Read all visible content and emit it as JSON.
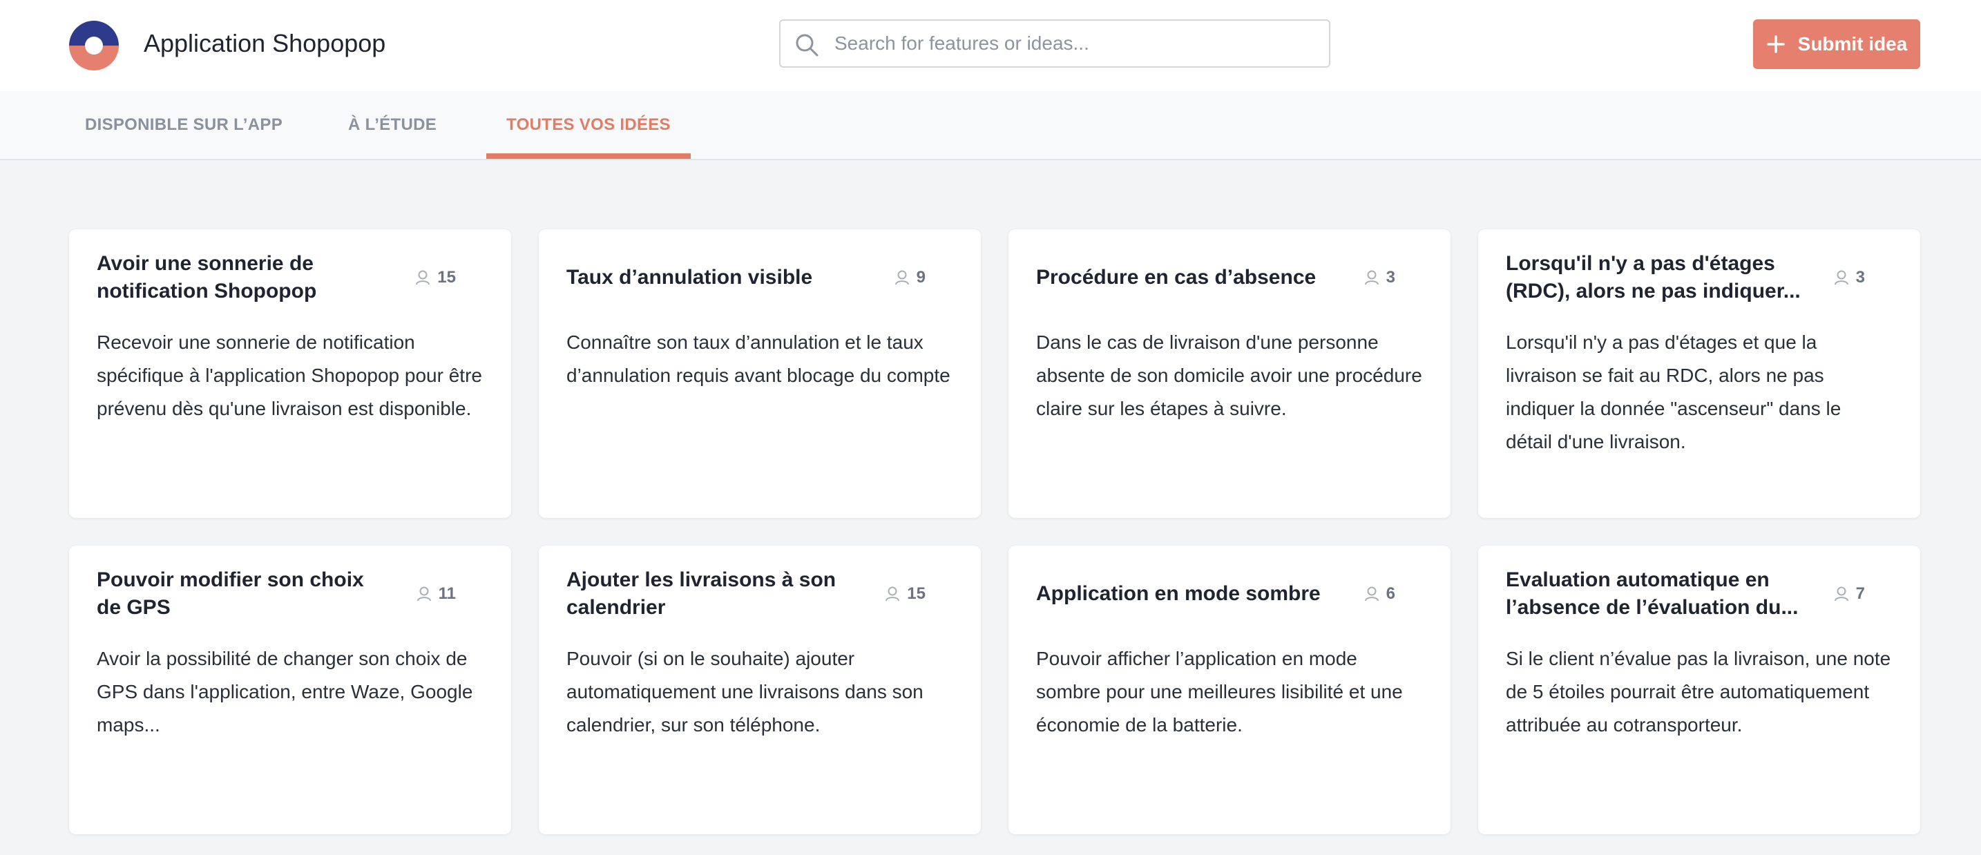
{
  "header": {
    "app_title": "Application Shopopop",
    "logo_colors": {
      "top": "#2e3a8c",
      "bottom": "#e5806e"
    },
    "search": {
      "placeholder": "Search for features or ideas...",
      "value": "",
      "icon": "search-icon"
    },
    "submit_button": {
      "label": "Submit idea",
      "icon": "plus-icon",
      "color": "#e5806e"
    }
  },
  "tabs": [
    {
      "label": "DISPONIBLE SUR L’APP",
      "active": false
    },
    {
      "label": "À L’ÉTUDE",
      "active": false
    },
    {
      "label": "TOUTES VOS IDÉES",
      "active": true
    }
  ],
  "accent_color": "#e37b65",
  "ideas": [
    {
      "title": "Avoir une sonnerie de notification Shopopop",
      "votes": "15",
      "description": "Recevoir une sonnerie de notification spécifique à l'application Shopopop pour être prévenu dès qu'une livraison est disponible."
    },
    {
      "title": "Taux d’annulation visible",
      "votes": "9",
      "description": "Connaître son taux d’annulation et le taux d’annulation requis avant blocage du compte"
    },
    {
      "title": "Procédure en cas d’absence",
      "votes": "3",
      "description": "Dans le cas de livraison d'une personne absente de son domicile avoir une procédure claire sur les étapes à suivre."
    },
    {
      "title": "Lorsqu'il n'y a pas d'étages (RDC), alors ne pas indiquer...",
      "votes": "3",
      "description": "Lorsqu'il n'y a pas d'étages et que la livraison se fait au RDC, alors ne pas indiquer la donnée \"ascenseur\" dans le détail d'une livraison."
    },
    {
      "title": "Pouvoir modifier son choix de GPS",
      "votes": "11",
      "description": "Avoir la possibilité de changer son choix de GPS dans l'application, entre Waze, Google maps..."
    },
    {
      "title": "Ajouter les livraisons à son calendrier",
      "votes": "15",
      "description": "Pouvoir (si on le souhaite) ajouter automatiquement une livraisons dans son calendrier, sur son téléphone."
    },
    {
      "title": "Application en mode sombre",
      "votes": "6",
      "description": "Pouvoir afficher l’application en mode sombre pour une meilleures lisibilité et une économie de la batterie."
    },
    {
      "title": "Evaluation automatique en l’absence de l’évaluation du...",
      "votes": "7",
      "description": "Si le client n’évalue pas la livraison, une note de 5 étoiles pourrait être automatiquement attribuée au cotransporteur."
    }
  ]
}
